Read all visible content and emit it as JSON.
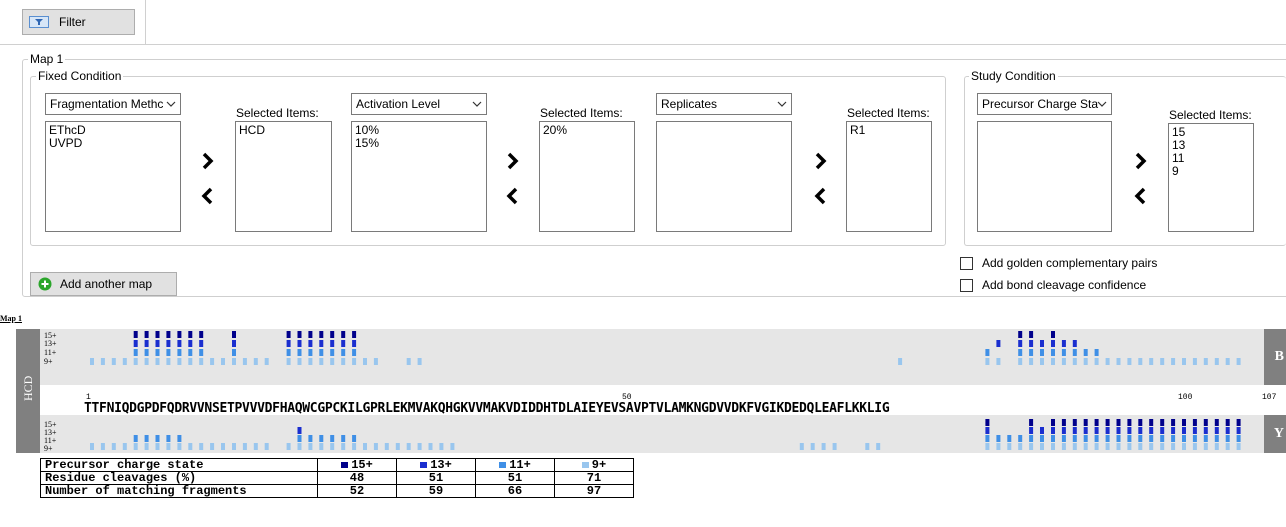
{
  "toolbar": {
    "filter_label": "Filter"
  },
  "map": {
    "title": "Map 1",
    "fixed_condition": {
      "title": "Fixed Condition",
      "groups": [
        {
          "dropdown": "Fragmentation Methc",
          "items": [
            "EThcD",
            "UVPD"
          ],
          "selected_label": "Selected Items:",
          "selected": [
            "HCD"
          ]
        },
        {
          "dropdown": "Activation Level",
          "items": [
            "10%",
            "15%"
          ],
          "selected_label": "Selected Items:",
          "selected": [
            "20%"
          ]
        },
        {
          "dropdown": "Replicates",
          "items": [],
          "selected_label": "Selected Items:",
          "selected": [
            "R1"
          ]
        }
      ]
    },
    "study_condition": {
      "title": "Study Condition",
      "dropdown": "Precursor Charge Sta",
      "items": [],
      "selected_label": "Selected Items:",
      "selected": [
        "15",
        "13",
        "11",
        "9"
      ]
    },
    "add_map_label": "Add another map",
    "checkbox_golden": "Add golden complementary pairs",
    "checkbox_bond": "Add bond cleavage confidence"
  },
  "colors": {
    "15+": "#00008b",
    "13+": "#1a2ecf",
    "11+": "#3f8fe6",
    "9+": "#99c6ee"
  },
  "plot": {
    "map_label": "Map 1",
    "row_label": "HCD",
    "b_label": "B",
    "y_label": "Y",
    "charges": [
      "15+",
      "13+",
      "11+",
      "9+"
    ],
    "sequence": "TTFNIQDGPDFQDRVVNSETPVVVDFHAQWCGPCKILGPRLEKMVAKQHGKVVMAKVDIDDHTDLAIEYEVSAVPTVLAMKNGDVVDKFVGIKDEDQLEAFLKKLIG",
    "positions": [
      "1",
      "50",
      "100",
      "107"
    ],
    "b_ions": {
      "15+": [
        5,
        6,
        7,
        8,
        9,
        10,
        11,
        14,
        19,
        20,
        21,
        22,
        23,
        24,
        25,
        86,
        87,
        89
      ],
      "13+": [
        5,
        6,
        7,
        8,
        9,
        10,
        11,
        14,
        19,
        20,
        21,
        22,
        23,
        24,
        25,
        84,
        86,
        87,
        88,
        89,
        90,
        91
      ],
      "11+": [
        5,
        6,
        7,
        8,
        9,
        10,
        11,
        14,
        19,
        20,
        21,
        22,
        23,
        24,
        25,
        83,
        86,
        87,
        88,
        89,
        90,
        91,
        92,
        93
      ],
      "9+": [
        1,
        2,
        3,
        4,
        5,
        6,
        7,
        8,
        9,
        10,
        11,
        12,
        13,
        14,
        15,
        16,
        17,
        19,
        20,
        21,
        22,
        23,
        24,
        25,
        26,
        27,
        30,
        31,
        75,
        83,
        84,
        86,
        87,
        88,
        89,
        90,
        91,
        92,
        93,
        94,
        95,
        96,
        97,
        98,
        99,
        100,
        101,
        102,
        103,
        104,
        105,
        106
      ]
    },
    "y_ions": {
      "15+": [
        83,
        87,
        89,
        90,
        91,
        92,
        93,
        94,
        95,
        96,
        97,
        98,
        99,
        100,
        101,
        102,
        103,
        104,
        105,
        106
      ],
      "13+": [
        20,
        83,
        87,
        88,
        89,
        90,
        91,
        92,
        93,
        94,
        95,
        96,
        97,
        98,
        99,
        100,
        101,
        102,
        103,
        104,
        105,
        106
      ],
      "11+": [
        5,
        6,
        7,
        8,
        9,
        20,
        21,
        22,
        23,
        24,
        25,
        83,
        84,
        85,
        86,
        87,
        88,
        89,
        90,
        91,
        92,
        93,
        94,
        95,
        96,
        97,
        98,
        99,
        100,
        101,
        102,
        103,
        104,
        105,
        106
      ],
      "9+": [
        1,
        2,
        3,
        4,
        5,
        6,
        7,
        8,
        9,
        10,
        11,
        12,
        13,
        14,
        15,
        16,
        17,
        19,
        20,
        21,
        22,
        23,
        24,
        25,
        26,
        27,
        28,
        29,
        30,
        31,
        32,
        33,
        34,
        66,
        67,
        68,
        69,
        72,
        73,
        83,
        84,
        85,
        86,
        87,
        88,
        89,
        90,
        91,
        92,
        93,
        94,
        95,
        96,
        97,
        98,
        99,
        100,
        101,
        102,
        103,
        104,
        105,
        106
      ]
    }
  },
  "stats": {
    "headers": [
      "Precursor charge state",
      "15+",
      "13+",
      "11+",
      "9+"
    ],
    "rows": [
      [
        "Residue cleavages (%)",
        "48",
        "51",
        "51",
        "71"
      ],
      [
        "Number of matching fragments",
        "52",
        "59",
        "66",
        "97"
      ]
    ]
  }
}
